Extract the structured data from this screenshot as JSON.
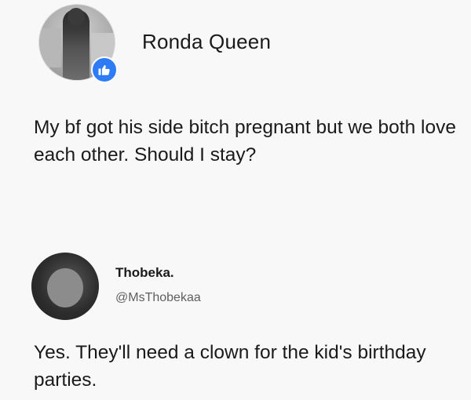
{
  "post": {
    "author": "Ronda Queen",
    "text": "My bf got his side bitch pregnant but we both love each other. Should I stay?",
    "badge_icon": "like-thumb-icon",
    "badge_color": "#2d7cf6"
  },
  "reply": {
    "name": "Thobeka.",
    "handle": "@MsThobekaa",
    "text": "Yes. They'll need a clown for the kid's birthday parties."
  }
}
